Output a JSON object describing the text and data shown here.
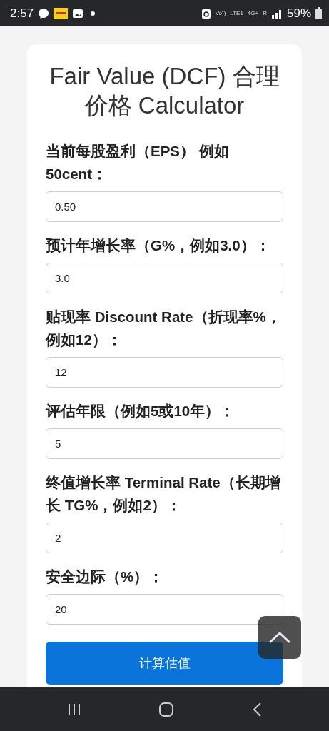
{
  "status_bar": {
    "time": "2:57",
    "signal_texts": [
      "Vo))",
      "LTE1",
      "4G+",
      "R"
    ],
    "battery": "59%"
  },
  "title": "Fair Value (DCF) 合理价格 Calculator",
  "fields": [
    {
      "label": "当前每股盈利（EPS） 例如 50cent：",
      "value": "0.50"
    },
    {
      "label": "预计年增长率（G%，例如3.0）：",
      "value": "3.0"
    },
    {
      "label": "贴现率 Discount Rate（折现率%，例如12）：",
      "value": "12"
    },
    {
      "label": "评估年限（例如5或10年）：",
      "value": "5"
    },
    {
      "label": "终值增长率 Terminal Rate（长期增长 TG%，例如2）：",
      "value": "2"
    },
    {
      "label": "安全边际（%）：",
      "value": "20"
    }
  ],
  "submit_button": "计算估值"
}
